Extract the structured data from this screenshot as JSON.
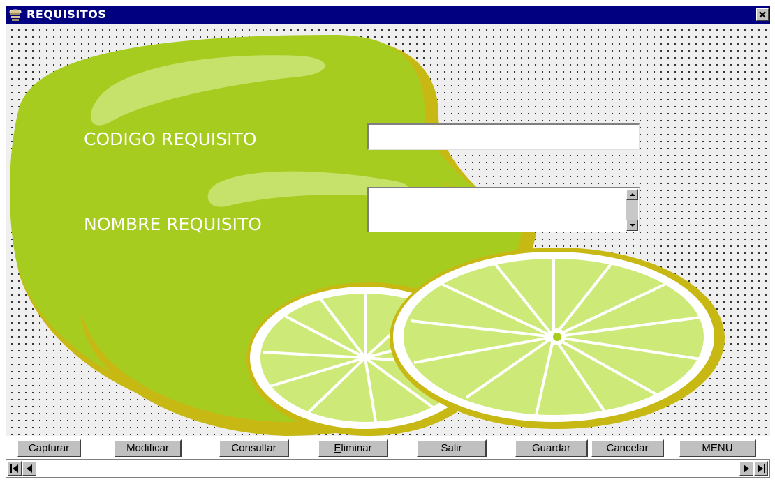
{
  "window": {
    "title": "REQUISITOS"
  },
  "form": {
    "codigo_label": "CODIGO REQUISITO",
    "codigo_value": "",
    "nombre_label": "NOMBRE REQUISITO",
    "nombre_value": ""
  },
  "buttons": {
    "capturar": "Capturar",
    "modificar": "Modificar",
    "consultar": "Consultar",
    "eliminar_mnemonic": "E",
    "eliminar_rest": "liminar",
    "salir": "Salir",
    "guardar": "Guardar",
    "cancelar": "Cancelar",
    "menu": "MENU"
  },
  "colors": {
    "titlebar": "#000080",
    "lime": "#a8d020",
    "lime_dark": "#c8b410",
    "lime_light": "#cfe878"
  },
  "icons": [
    "app-icon",
    "close-icon",
    "scroll-up-icon",
    "scroll-down-icon",
    "first-record-icon",
    "previous-record-icon",
    "next-record-icon",
    "last-record-icon"
  ]
}
